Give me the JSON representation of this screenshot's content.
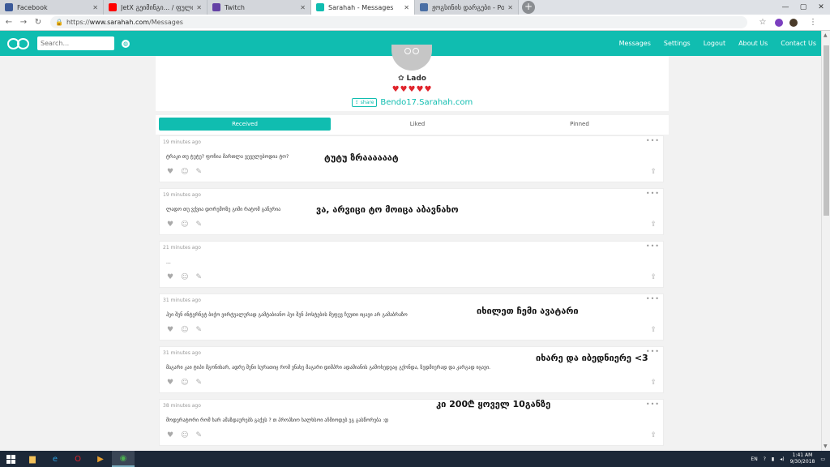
{
  "browser": {
    "tabs": [
      {
        "title": "Facebook",
        "color": "#3b5998"
      },
      {
        "title": "JetX გეიმინგი... / ფული 1000$ -",
        "color": "#ff0000"
      },
      {
        "title": "Twitch",
        "color": "#6441a5"
      },
      {
        "title": "Sarahah - Messages",
        "color": "#10bdb0"
      },
      {
        "title": "ჟოგსინის დარგები - Powered",
        "color": "#4a6fa5"
      }
    ],
    "url_prefix": "https://",
    "url_host": "www.sarahah.com",
    "url_path": "/Messages"
  },
  "navbar": {
    "search_placeholder": "Search...",
    "menu": [
      "Messages",
      "Settings",
      "Logout",
      "About Us",
      "Contact Us"
    ]
  },
  "profile": {
    "name": "Lado",
    "hearts": "♥♥♥♥♥",
    "share_label": "share",
    "link": "Bendo17.Sarahah.com"
  },
  "tabs": [
    "Received",
    "Liked",
    "Pinned"
  ],
  "messages": [
    {
      "time": "19 minutes ago",
      "text": "ტრაკი თუ ტუტუ? ფოჩია მართლა ვეველებოდია ტო?",
      "overlay": "ტუტუ ზრაააააატ"
    },
    {
      "time": "19 minutes ago",
      "text": "ლადო თუ ვქვია დორემოზე გიმი რატომ გაწერია",
      "overlay": "ვა, არვიცი ტო მოიცა აბავნახო"
    },
    {
      "time": "21 minutes ago",
      "text": "...",
      "overlay": ""
    },
    {
      "time": "31 minutes ago",
      "text": "ჰეი შენ ინტერნეტ ბიჭო ვირტუალურად გამტაბიანო ჰეი შენ პოსტების მეფევ ჩუუთი იცავი არ გამაბრაზო",
      "overlay": "იხილეთ ჩემი ავატარი"
    },
    {
      "time": "31 minutes ago",
      "text": "მაგარი კაი ტიპი მგონიხარ, ადრე შენი სურათიც რომ ვნახე მაგარი დიმპრი ადამიანის გამოხედვაც გქონდა, ზედმიერად და კარგად იცავი.",
      "overlay": "იხარე და იბედნიერე <3"
    },
    {
      "time": "38 minutes ago",
      "text": "მოდერატორი რომ ხარ ამაზდაურებს გაქვს ? თ პროპსიო ხალხსოი აჩმიოდებ ეგ გასწორება :დ",
      "overlay": "კი 200₾ ყოველ 10განზე"
    }
  ],
  "taskbar": {
    "lang": "EN",
    "time": "1:41 AM",
    "date": "9/30/2018"
  }
}
